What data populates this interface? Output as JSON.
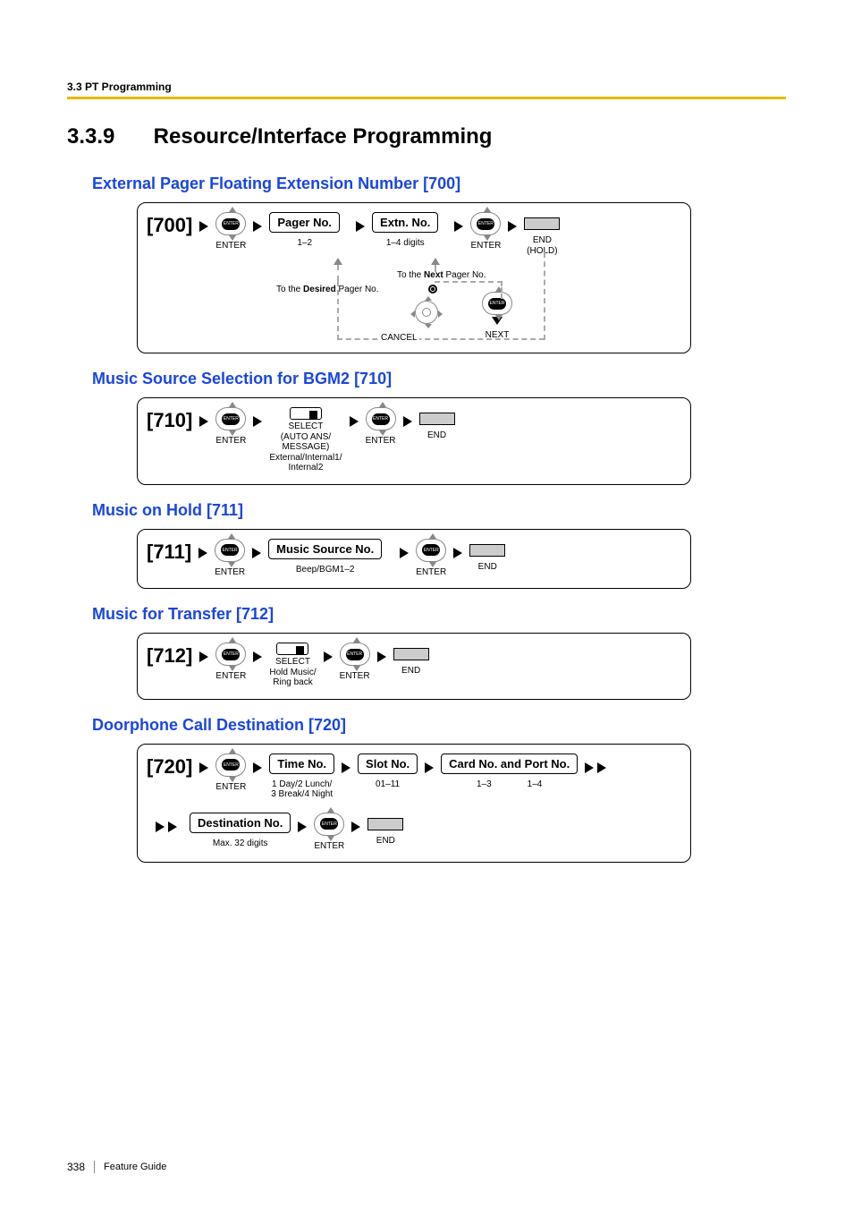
{
  "header": {
    "breadcrumb": "3.3 PT Programming"
  },
  "section": {
    "number": "3.3.9",
    "title": "Resource/Interface Programming"
  },
  "footer": {
    "page": "338",
    "book": "Feature Guide"
  },
  "items": [
    {
      "title": "External Pager Floating Extension Number [700]",
      "code": "[700]",
      "steps": {
        "enter1": "ENTER",
        "box1": "Pager No.",
        "sub1": "1–2",
        "box2": "Extn. No.",
        "sub2": "1–4 digits",
        "enter2": "ENTER",
        "end": "END\n(HOLD)",
        "note_next": "To the Next Pager No.",
        "note_desired": "To the Desired Pager No.",
        "cancel": "CANCEL",
        "next": "NEXT"
      }
    },
    {
      "title": "Music Source Selection for BGM2 [710]",
      "code": "[710]",
      "steps": {
        "enter1": "ENTER",
        "select_top": "SELECT",
        "select_mid": "(AUTO ANS/\nMESSAGE)",
        "select_bot": "External/Internal1/\nInternal2",
        "enter2": "ENTER",
        "end": "END"
      }
    },
    {
      "title": "Music on Hold [711]",
      "code": "[711]",
      "steps": {
        "enter1": "ENTER",
        "box1": "Music Source No.",
        "sub1": "Beep/BGM1–2",
        "enter2": "ENTER",
        "end": "END"
      }
    },
    {
      "title": "Music for Transfer [712]",
      "code": "[712]",
      "steps": {
        "enter1": "ENTER",
        "select_top": "SELECT",
        "select_bot": "Hold Music/\nRing back",
        "enter2": "ENTER",
        "end": "END"
      }
    },
    {
      "title": "Doorphone Call Destination [720]",
      "code": "[720]",
      "steps": {
        "enter1": "ENTER",
        "box1": "Time No.",
        "sub1": "1 Day/2 Lunch/\n3 Break/4 Night",
        "box2": "Slot No.",
        "sub2": "01–11",
        "box3": "Card No. and Port No.",
        "sub3a": "1–3",
        "sub3b": "1–4",
        "box4": "Destination No.",
        "sub4": "Max. 32 digits",
        "enter2": "ENTER",
        "end": "END"
      }
    }
  ]
}
